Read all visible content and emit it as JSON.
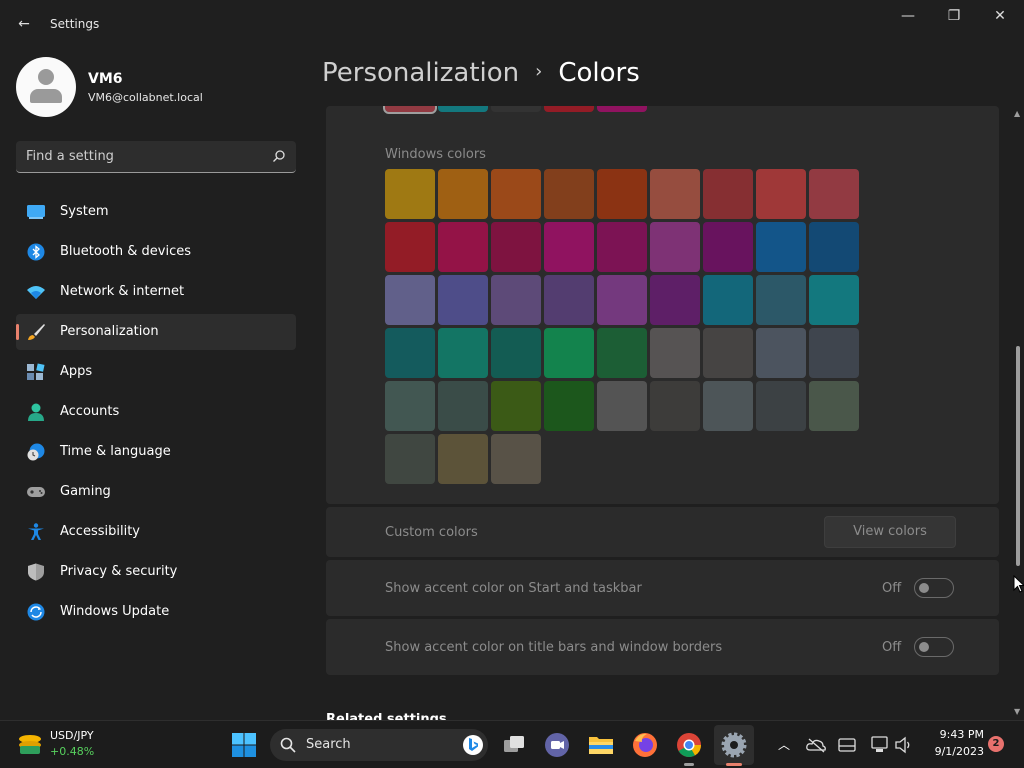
{
  "window": {
    "app_title": "Settings",
    "minimize_glyph": "—",
    "maximize_glyph": "❐",
    "close_glyph": "✕",
    "back_glyph": "←"
  },
  "profile": {
    "name": "VM6",
    "email": "VM6@collabnet.local"
  },
  "search": {
    "placeholder": "Find a setting"
  },
  "sidebar": {
    "items": [
      {
        "label": "System",
        "icon": "system-icon",
        "active": false
      },
      {
        "label": "Bluetooth & devices",
        "icon": "bluetooth-icon",
        "active": false
      },
      {
        "label": "Network & internet",
        "icon": "wifi-icon",
        "active": false
      },
      {
        "label": "Personalization",
        "icon": "brush-icon",
        "active": true
      },
      {
        "label": "Apps",
        "icon": "apps-icon",
        "active": false
      },
      {
        "label": "Accounts",
        "icon": "person-icon",
        "active": false
      },
      {
        "label": "Time & language",
        "icon": "clock-globe-icon",
        "active": false
      },
      {
        "label": "Gaming",
        "icon": "controller-icon",
        "active": false
      },
      {
        "label": "Accessibility",
        "icon": "accessibility-icon",
        "active": false
      },
      {
        "label": "Privacy & security",
        "icon": "shield-icon",
        "active": false
      },
      {
        "label": "Windows Update",
        "icon": "update-icon",
        "active": false
      }
    ]
  },
  "header": {
    "breadcrumb_parent": "Personalization",
    "separator": "›",
    "page_title": "Colors"
  },
  "colors": {
    "section_label": "Windows colors",
    "recent_colors": [
      "#e74856",
      "#00b7c3",
      "#3a3a3a",
      "#e81123",
      "#e3008c"
    ],
    "palette": [
      [
        "#ffb900",
        "#ff8c00",
        "#f7630c",
        "#ca5010",
        "#da3b01",
        "#ef6950",
        "#d13438",
        "#ff4343",
        "#e74856"
      ],
      [
        "#e81123",
        "#ea005e",
        "#c30052",
        "#e3008c",
        "#bf0077",
        "#c239b3",
        "#9a0089",
        "#0078d7",
        "#0063b1"
      ],
      [
        "#8e8cd8",
        "#6b69d6",
        "#8764b8",
        "#744da9",
        "#b146c2",
        "#881798",
        "#0099bc",
        "#2d7d9a",
        "#00b7c3"
      ],
      [
        "#038387",
        "#00b294",
        "#018574",
        "#00cc6a",
        "#10893e",
        "#7a7574",
        "#5d5a58",
        "#68768a",
        "#515c6b"
      ],
      [
        "#567c73",
        "#486860",
        "#498205",
        "#107c10",
        "#767676",
        "#4c4a48",
        "#69797e",
        "#4a5459",
        "#647c64"
      ],
      [
        "#525e54",
        "#847545",
        "#7e735f"
      ]
    ],
    "custom_colors_label": "Custom colors",
    "view_colors_button": "View colors",
    "accent_start_label": "Show accent color on Start and taskbar",
    "accent_start_state": "Off",
    "accent_title_label": "Show accent color on title bars and window borders",
    "accent_title_state": "Off",
    "related_settings": "Related settings"
  },
  "taskbar": {
    "ticker_symbol": "USD/JPY",
    "ticker_change": "+0.48%",
    "search_label": "Search",
    "time": "9:43 PM",
    "date": "9/1/2023",
    "notification_count": "2",
    "accent": "#e8816d"
  }
}
